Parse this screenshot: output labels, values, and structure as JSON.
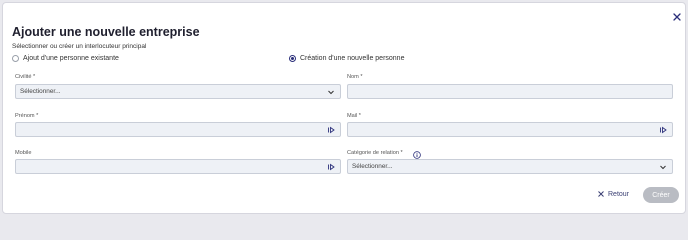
{
  "modal": {
    "title": "Ajouter une nouvelle entreprise",
    "subtitle": "Sélectionner ou créer un interlocuteur principal"
  },
  "options": {
    "existing": "Ajout d'une personne existante",
    "new": "Création d'une nouvelle personne",
    "selected": "new"
  },
  "fields": {
    "civilite": {
      "label": "Civilité *",
      "placeholder": "Sélectionner..."
    },
    "nom": {
      "label": "Nom *",
      "value": ""
    },
    "prenom": {
      "label": "Prénom *",
      "value": ""
    },
    "mail": {
      "label": "Mail *",
      "value": ""
    },
    "mobile": {
      "label": "Mobile",
      "value": ""
    },
    "categorie": {
      "label": "Catégorie de relation *",
      "placeholder": "Sélectionner..."
    }
  },
  "footer": {
    "back_label": "Retour",
    "create_label": "Créer"
  },
  "colors": {
    "accent": "#2b2f7a",
    "field_bg": "#eef1f6",
    "disabled_button": "#b9bcc3"
  }
}
